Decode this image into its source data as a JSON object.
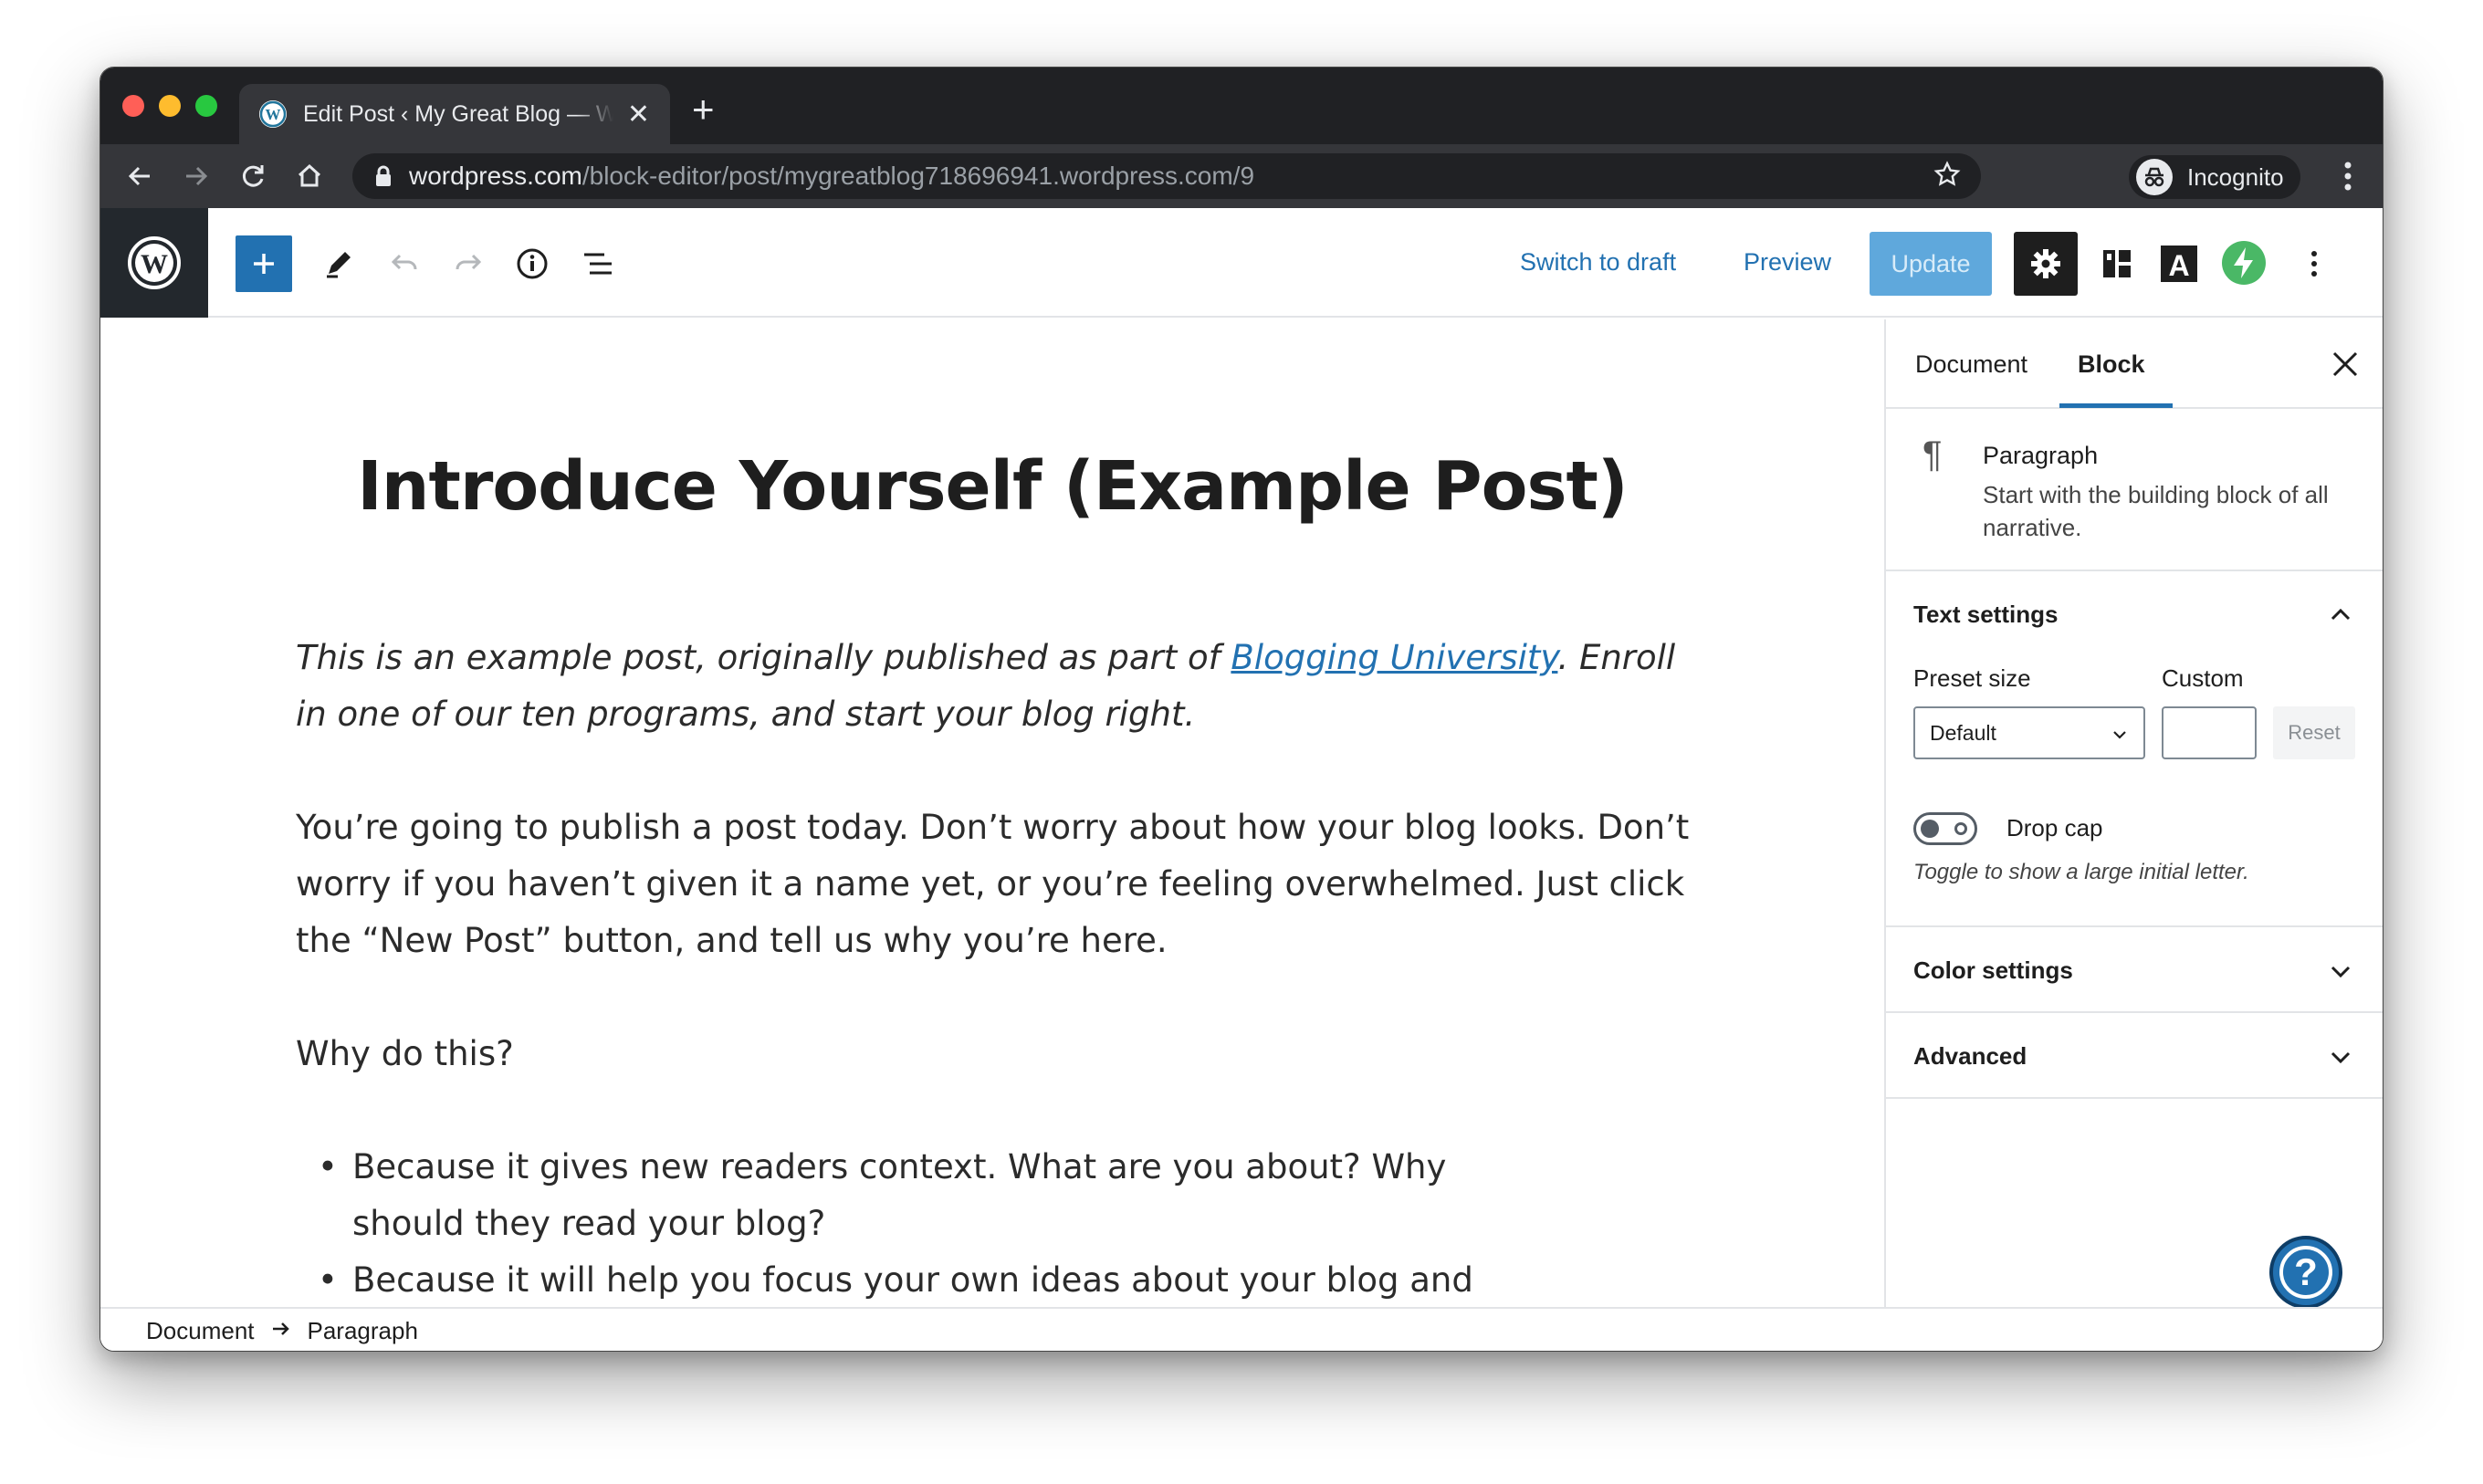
{
  "browser": {
    "tab_title": "Edit Post ‹ My Great Blog — WordPress.com",
    "url_host": "wordpress.com",
    "url_path": "/block-editor/post/mygreatblog718696941.wordpress.com/9",
    "profile_label": "Incognito"
  },
  "toolbar": {
    "switch_to_draft": "Switch to draft",
    "preview": "Preview",
    "update": "Update"
  },
  "post": {
    "title": "Introduce Yourself (Example Post)",
    "intro_before": "This is an example post, originally published as part of ",
    "intro_link": "Blogging University",
    "intro_after": ". Enroll in one of our ten programs, and start your blog right.",
    "para1": "You’re going to publish a post today. Don’t worry about how your blog looks. Don’t worry if you haven’t given it a name yet, or you’re feeling overwhelmed. Just click the “New Post” button, and tell us why you’re here.",
    "para2": "Why do this?",
    "bullets": [
      "Because it gives new readers context. What are you about? Why should they read your blog?",
      "Because it will help you focus your own ideas about your blog and what you’d"
    ]
  },
  "sidebar": {
    "tab_document": "Document",
    "tab_block": "Block",
    "block_name": "Paragraph",
    "block_desc": "Start with the building block of all narrative.",
    "text_settings": "Text settings",
    "preset_size_label": "Preset size",
    "custom_label": "Custom",
    "preset_value": "Default",
    "reset": "Reset",
    "drop_cap": "Drop cap",
    "drop_cap_help": "Toggle to show a large initial letter.",
    "color_settings": "Color settings",
    "advanced": "Advanced"
  },
  "footer": {
    "crumb_1": "Document",
    "crumb_2": "Paragraph"
  },
  "colors": {
    "accent": "#2271b1",
    "jetpack": "#4ab866",
    "dark": "#1e1e1e"
  }
}
